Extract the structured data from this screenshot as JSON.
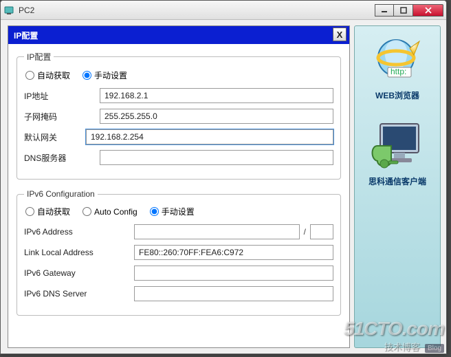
{
  "window": {
    "title": "PC2"
  },
  "dialog": {
    "title": "IP配置",
    "close_label": "X",
    "ipv4": {
      "legend": "IP配置",
      "radio_auto": "自动获取",
      "radio_manual": "手动设置",
      "label_ip": "IP地址",
      "value_ip": "192.168.2.1",
      "label_mask": "子网掩码",
      "value_mask": "255.255.255.0",
      "label_gw": "默认网关",
      "value_gw": "192.168.2.254",
      "label_dns": "DNS服务器",
      "value_dns": ""
    },
    "ipv6": {
      "legend": "IPv6 Configuration",
      "radio_auto": "自动获取",
      "radio_autoconfig": "Auto Config",
      "radio_manual": "手动设置",
      "label_addr": "IPv6 Address",
      "value_addr": "",
      "slash": "/",
      "value_prefix": "",
      "label_linklocal": "Link Local Address",
      "value_linklocal": "FE80::260:70FF:FEA6:C972",
      "label_gw": "IPv6 Gateway",
      "value_gw": "",
      "label_dns": "IPv6 DNS Server",
      "value_dns": ""
    }
  },
  "sidebar": {
    "web": "WEB浏览器",
    "cisco": "思科通信客户端"
  },
  "watermark": {
    "brand": "51CTO.com",
    "sub": "技术博客",
    "badge": "Blog"
  }
}
